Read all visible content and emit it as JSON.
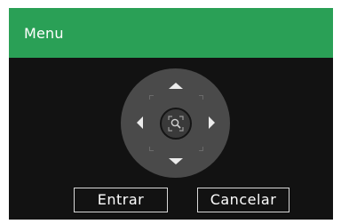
{
  "dialog": {
    "title": "Menu"
  },
  "ptz": {
    "up_icon": "arrow-up-icon",
    "down_icon": "arrow-down-icon",
    "left_icon": "arrow-left-icon",
    "right_icon": "arrow-right-icon",
    "center_icon": "zoom-search-icon"
  },
  "buttons": {
    "enter_label": "Entrar",
    "cancel_label": "Cancelar"
  },
  "colors": {
    "titlebar": "#2aa056",
    "background": "#121212",
    "ptz_ring": "#4a4a4a"
  }
}
